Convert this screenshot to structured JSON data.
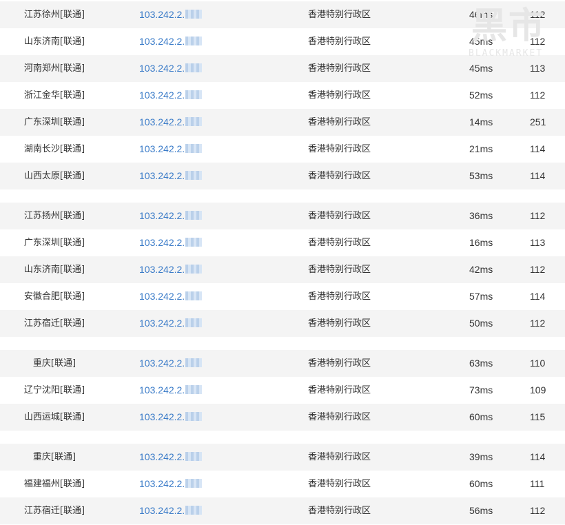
{
  "ip_prefix": "103.242.2.",
  "region": "香港特别行政区",
  "watermark": {
    "title": "黑市",
    "subtitle": "BLACKMARKET"
  },
  "rows": [
    {
      "location": "江苏徐州[联通]",
      "latency": "46ms",
      "count": "112"
    },
    {
      "location": "山东济南[联通]",
      "latency": "45ms",
      "count": "112"
    },
    {
      "location": "河南郑州[联通]",
      "latency": "45ms",
      "count": "113"
    },
    {
      "location": "浙江金华[联通]",
      "latency": "52ms",
      "count": "112"
    },
    {
      "location": "广东深圳[联通]",
      "latency": "14ms",
      "count": "251"
    },
    {
      "location": "湖南长沙[联通]",
      "latency": "21ms",
      "count": "114"
    },
    {
      "location": "山西太原[联通]",
      "latency": "53ms",
      "count": "114"
    },
    {
      "location": "江苏扬州[联通]",
      "latency": "36ms",
      "count": "112"
    },
    {
      "location": "广东深圳[联通]",
      "latency": "16ms",
      "count": "113"
    },
    {
      "location": "山东济南[联通]",
      "latency": "42ms",
      "count": "112"
    },
    {
      "location": "安徽合肥[联通]",
      "latency": "57ms",
      "count": "114"
    },
    {
      "location": "江苏宿迁[联通]",
      "latency": "50ms",
      "count": "112"
    },
    {
      "location": "重庆[联通]",
      "latency": "63ms",
      "count": "110"
    },
    {
      "location": "辽宁沈阳[联通]",
      "latency": "73ms",
      "count": "109"
    },
    {
      "location": "山西运城[联通]",
      "latency": "60ms",
      "count": "115"
    },
    {
      "location": "重庆[联通]",
      "latency": "39ms",
      "count": "114"
    },
    {
      "location": "福建福州[联通]",
      "latency": "60ms",
      "count": "111"
    },
    {
      "location": "江苏宿迁[联通]",
      "latency": "56ms",
      "count": "112"
    }
  ]
}
